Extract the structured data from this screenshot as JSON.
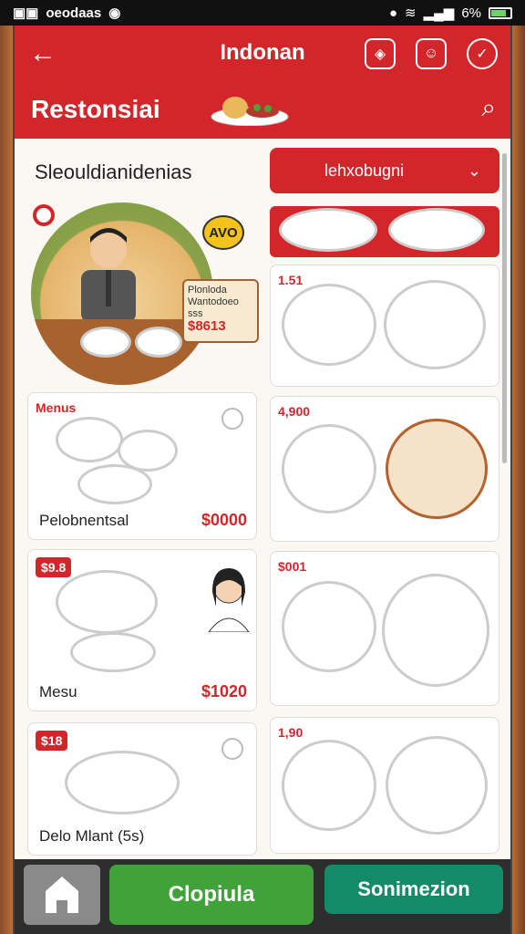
{
  "status_bar": {
    "left_text": "oeodaas",
    "battery": "6%"
  },
  "header": {
    "title": "Indonan",
    "subtitle": "Restonsiai"
  },
  "filter": {
    "section_title": "Sleouldianidenias",
    "dropdown_value": "lehxobugni"
  },
  "hero": {
    "badge": "AVO",
    "promo_lines": [
      "Plonloda",
      "Wantodoeo",
      "sss"
    ],
    "promo_price": "$8613"
  },
  "menu_cards": [
    {
      "tag": "Menus",
      "label": "Pelobnentsal",
      "price": "$0000"
    },
    {
      "tag": "$9.8",
      "label": "Mesu",
      "price": "$1020"
    },
    {
      "tag": "$18",
      "label": "Delo Mlant (5s)",
      "price": ""
    }
  ],
  "right_cards": [
    {
      "tag": "1.51"
    },
    {
      "tag": "4,900"
    },
    {
      "tag": "$001"
    },
    {
      "tag": "1,90"
    }
  ],
  "actions": {
    "primary": "Clopiula",
    "secondary": "Sonimezion"
  },
  "colors": {
    "primary_red": "#d3262a",
    "green": "#3fa33a",
    "teal": "#138a68"
  }
}
